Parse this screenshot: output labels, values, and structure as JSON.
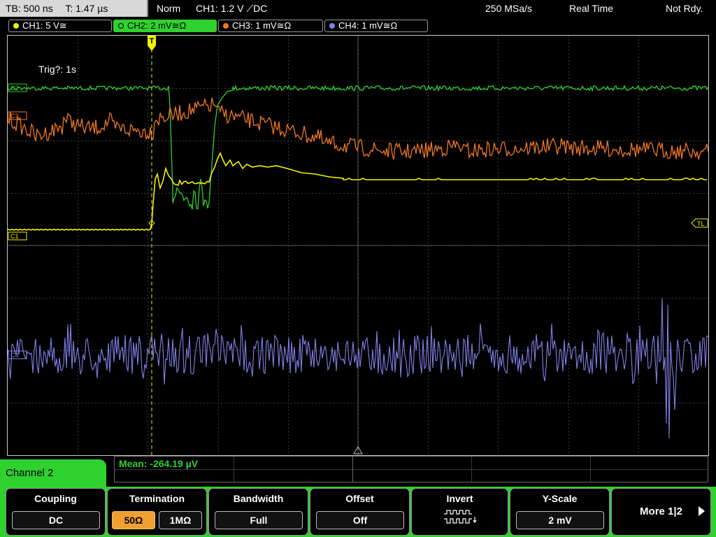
{
  "status": {
    "tb": "TB: 500 ns",
    "t": "T: 1.47 µs",
    "mode": "Norm",
    "trigger": "CH1: 1.2 V ⟋DC",
    "samplerate": "250 MSa/s",
    "acq": "Real Time",
    "state": "Not Rdy."
  },
  "channels": [
    {
      "label": "CH1: 5 V≅",
      "color": "#f2f200",
      "active": false
    },
    {
      "label": "CH2: 2 mV≅Ω",
      "color": "#2fd12f",
      "active": true
    },
    {
      "label": "CH3: 1 mV≅Ω",
      "color": "#f07820",
      "active": false
    },
    {
      "label": "CH4: 1 mV≅Ω",
      "color": "#8080e8",
      "active": false
    }
  ],
  "plot": {
    "trig_status": "Trig?: 1s",
    "markers": {
      "c1": "C1",
      "c2": "C2",
      "c3": "C3",
      "c4": "C4",
      "tl": "TL",
      "trig": "T"
    },
    "colors": {
      "ch1": "#f2f200",
      "ch2": "#2fd12f",
      "ch3": "#f07820",
      "ch4": "#8080e8",
      "grid": "#3a3a3a"
    }
  },
  "measurement": {
    "text": "Mean: -264.19 µV"
  },
  "menu": {
    "title": "Channel 2",
    "coupling": {
      "title": "Coupling",
      "value": "DC"
    },
    "termination": {
      "title": "Termination",
      "opt1": "50Ω",
      "opt2": "1MΩ",
      "selected": "50Ω"
    },
    "bandwidth": {
      "title": "Bandwidth",
      "value": "Full"
    },
    "offset": {
      "title": "Offset",
      "value": "Off"
    },
    "invert": {
      "title": "Invert",
      "icon": "invert-waveform-icon"
    },
    "yscale": {
      "title": "Y-Scale",
      "value": "2 mV"
    },
    "more": {
      "label": "More 1|2"
    }
  }
}
